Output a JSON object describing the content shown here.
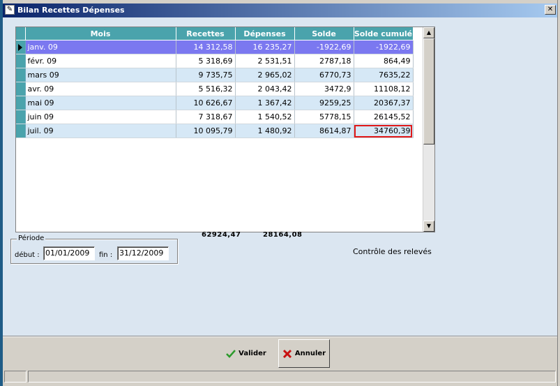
{
  "window": {
    "title": "Bilan Recettes Dépenses",
    "close_glyph": "✕"
  },
  "grid": {
    "columns": [
      "Mois",
      "Recettes",
      "Dépenses",
      "Solde",
      "Solde cumulé"
    ],
    "rows": [
      {
        "mois": "janv. 09",
        "recettes": "14 312,58",
        "depenses": "16 235,27",
        "solde": "-1922,69",
        "cumule": "-1922,69"
      },
      {
        "mois": "févr. 09",
        "recettes": "5 318,69",
        "depenses": "2 531,51",
        "solde": "2787,18",
        "cumule": "864,49"
      },
      {
        "mois": "mars 09",
        "recettes": "9 735,75",
        "depenses": "2 965,02",
        "solde": "6770,73",
        "cumule": "7635,22"
      },
      {
        "mois": "avr. 09",
        "recettes": "5 516,32",
        "depenses": "2 043,42",
        "solde": "3472,9",
        "cumule": "11108,12"
      },
      {
        "mois": "mai 09",
        "recettes": "10 626,67",
        "depenses": "1 367,42",
        "solde": "9259,25",
        "cumule": "20367,37"
      },
      {
        "mois": "juin 09",
        "recettes": "7 318,67",
        "depenses": "1 540,52",
        "solde": "5778,15",
        "cumule": "26145,52"
      },
      {
        "mois": "juil. 09",
        "recettes": "10 095,79",
        "depenses": "1 480,92",
        "solde": "8614,87",
        "cumule": "34760,39"
      }
    ],
    "totals": {
      "recettes": "62924,47",
      "depenses": "28164,08"
    }
  },
  "periode": {
    "legend": "Période",
    "debut_label": "début :",
    "debut_value": "01/01/2009",
    "fin_label": "fin :",
    "fin_value": "31/12/2009"
  },
  "controle_label": "Contrôle des relevés",
  "buttons": {
    "valider": "Valider",
    "annuler": "Annuler",
    "valider_icon": "check-icon",
    "annuler_icon": "x-icon"
  },
  "colors": {
    "header": "#4aa3ac",
    "selected_row": "#7b78f0",
    "alt_row": "#d6e8f6",
    "highlight": "#e01818"
  }
}
